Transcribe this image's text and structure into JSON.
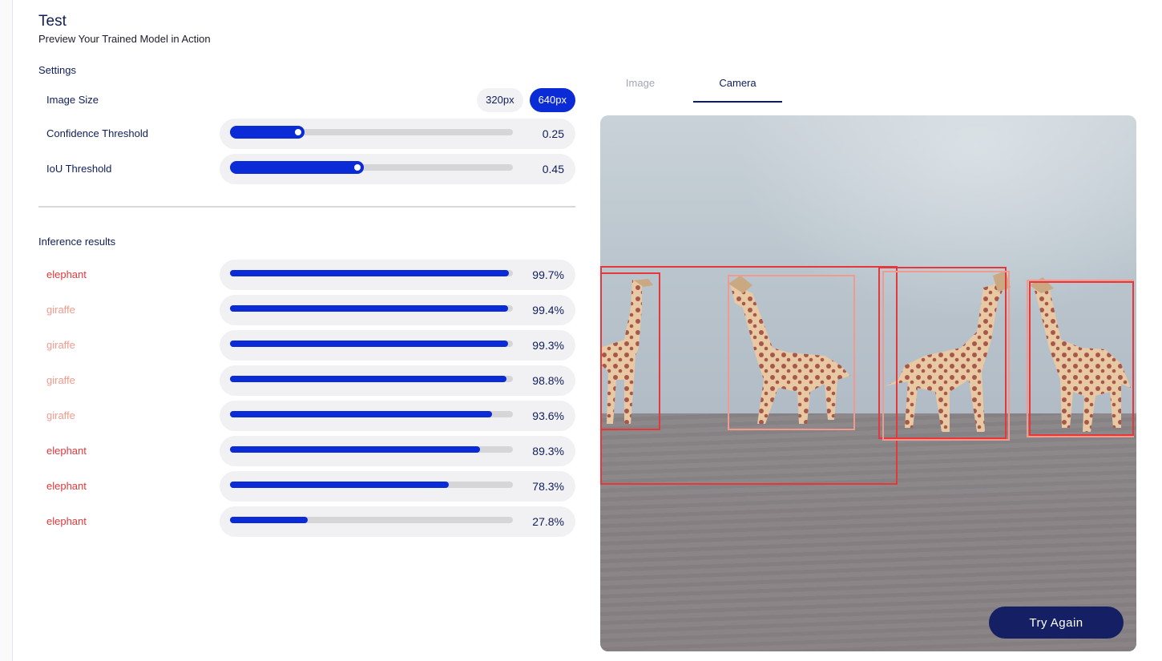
{
  "header": {
    "title": "Test",
    "subtitle": "Preview Your Trained Model in Action"
  },
  "settings": {
    "label": "Settings",
    "image_size": {
      "label": "Image Size",
      "options": [
        "320px",
        "640px"
      ],
      "selected": "640px"
    },
    "confidence": {
      "label": "Confidence Threshold",
      "value": "0.25",
      "fraction": 0.25
    },
    "iou": {
      "label": "IoU Threshold",
      "value": "0.45",
      "fraction": 0.45
    }
  },
  "results": {
    "label": "Inference results",
    "items": [
      {
        "class": "elephant",
        "score": "99.7%",
        "fraction": 0.997
      },
      {
        "class": "giraffe",
        "score": "99.4%",
        "fraction": 0.994
      },
      {
        "class": "giraffe",
        "score": "99.3%",
        "fraction": 0.993
      },
      {
        "class": "giraffe",
        "score": "98.8%",
        "fraction": 0.988
      },
      {
        "class": "giraffe",
        "score": "93.6%",
        "fraction": 0.936
      },
      {
        "class": "elephant",
        "score": "89.3%",
        "fraction": 0.893
      },
      {
        "class": "elephant",
        "score": "78.3%",
        "fraction": 0.783
      },
      {
        "class": "elephant",
        "score": "27.8%",
        "fraction": 0.278
      }
    ]
  },
  "tabs": {
    "image": "Image",
    "camera": "Camera",
    "active": "Camera"
  },
  "camera": {
    "button": "Try Again"
  },
  "colors": {
    "accent": "#0b2bd6",
    "elephant": "#e5383b",
    "giraffe": "#f29a8e",
    "navy": "#0f1e5a",
    "button": "#142063"
  }
}
